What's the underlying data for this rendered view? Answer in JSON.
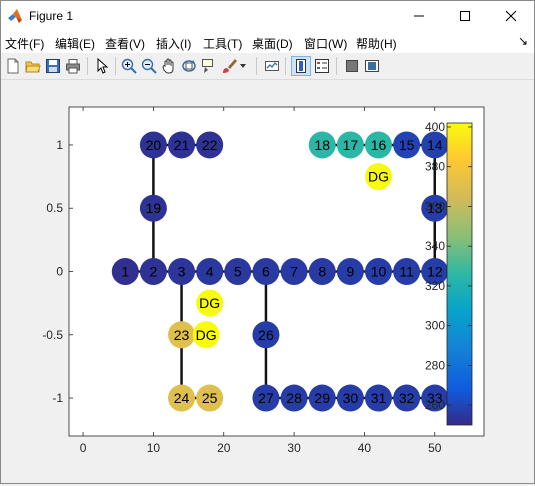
{
  "window": {
    "title": "Figure 1"
  },
  "window_controls": {
    "minimize": "minimize",
    "maximize": "maximize",
    "close": "close"
  },
  "menu": [
    "文件(F)",
    "编辑(E)",
    "查看(V)",
    "插入(I)",
    "工具(T)",
    "桌面(D)",
    "窗口(W)",
    "帮助(H)"
  ],
  "toolbar_icons": [
    "new-figure-icon",
    "open-file-icon",
    "save-icon",
    "print-icon",
    "pointer-icon",
    "zoom-in-icon",
    "zoom-out-icon",
    "pan-icon",
    "rotate-3d-icon",
    "data-cursor-icon",
    "brush-icon",
    "brush-dropdown-icon",
    "link-plot-icon",
    "insert-colorbar-icon",
    "insert-legend-icon",
    "hide-plot-tools-icon",
    "show-plot-tools-icon"
  ],
  "chart_data": {
    "type": "network graph",
    "x_ticks": [
      "0",
      "10",
      "20",
      "30",
      "40",
      "50"
    ],
    "y_ticks": [
      "1",
      "0.5",
      "0",
      "-0.5",
      "-1"
    ],
    "xlim": [
      -2,
      57
    ],
    "ylim": [
      -1.3,
      1.3
    ],
    "colorbar": {
      "ticks": [
        "400",
        "380",
        "360",
        "340",
        "320",
        "300",
        "280",
        "260"
      ],
      "range": [
        250,
        402
      ],
      "colormap": "parula"
    },
    "nodes": [
      {
        "id": "1",
        "x": 6,
        "y": 0,
        "value": 252
      },
      {
        "id": "2",
        "x": 10,
        "y": 0,
        "value": 253
      },
      {
        "id": "3",
        "x": 14,
        "y": 0,
        "value": 254
      },
      {
        "id": "4",
        "x": 18,
        "y": 0,
        "value": 255
      },
      {
        "id": "5",
        "x": 22,
        "y": 0,
        "value": 255
      },
      {
        "id": "6",
        "x": 26,
        "y": 0,
        "value": 256
      },
      {
        "id": "7",
        "x": 30,
        "y": 0,
        "value": 256
      },
      {
        "id": "8",
        "x": 34,
        "y": 0,
        "value": 256
      },
      {
        "id": "9",
        "x": 38,
        "y": 0,
        "value": 257
      },
      {
        "id": "10",
        "x": 42,
        "y": 0,
        "value": 257
      },
      {
        "id": "11",
        "x": 46,
        "y": 0,
        "value": 257
      },
      {
        "id": "12",
        "x": 50,
        "y": 0,
        "value": 257
      },
      {
        "id": "13",
        "x": 50,
        "y": 0.5,
        "value": 257
      },
      {
        "id": "14",
        "x": 50,
        "y": 1,
        "value": 258
      },
      {
        "id": "15",
        "x": 46,
        "y": 1,
        "value": 259
      },
      {
        "id": "16",
        "x": 42,
        "y": 1,
        "value": 325
      },
      {
        "id": "17",
        "x": 38,
        "y": 1,
        "value": 325
      },
      {
        "id": "18",
        "x": 34,
        "y": 1,
        "value": 325
      },
      {
        "id": "19",
        "x": 10,
        "y": 0.5,
        "value": 253
      },
      {
        "id": "20",
        "x": 10,
        "y": 1,
        "value": 253
      },
      {
        "id": "21",
        "x": 14,
        "y": 1,
        "value": 253
      },
      {
        "id": "22",
        "x": 18,
        "y": 1,
        "value": 253
      },
      {
        "id": "23",
        "x": 14,
        "y": -0.5,
        "value": 370
      },
      {
        "id": "24",
        "x": 14,
        "y": -1,
        "value": 370
      },
      {
        "id": "25",
        "x": 18,
        "y": -1,
        "value": 370
      },
      {
        "id": "26",
        "x": 26,
        "y": -0.5,
        "value": 257
      },
      {
        "id": "27",
        "x": 26,
        "y": -1,
        "value": 257
      },
      {
        "id": "28",
        "x": 30,
        "y": -1,
        "value": 257
      },
      {
        "id": "29",
        "x": 34,
        "y": -1,
        "value": 257
      },
      {
        "id": "30",
        "x": 38,
        "y": -1,
        "value": 257
      },
      {
        "id": "31",
        "x": 42,
        "y": -1,
        "value": 257
      },
      {
        "id": "32",
        "x": 46,
        "y": -1,
        "value": 257
      },
      {
        "id": "33",
        "x": 50,
        "y": -1,
        "value": 257
      },
      {
        "id": "DG",
        "x": 42,
        "y": 0.75,
        "value": 402
      },
      {
        "id": "DG",
        "x": 18,
        "y": -0.25,
        "value": 402
      },
      {
        "id": "DG",
        "x": 17.5,
        "y": -0.5,
        "value": 402
      }
    ],
    "edges": [
      [
        "1",
        "2"
      ],
      [
        "2",
        "3"
      ],
      [
        "3",
        "4"
      ],
      [
        "4",
        "5"
      ],
      [
        "5",
        "6"
      ],
      [
        "6",
        "7"
      ],
      [
        "7",
        "8"
      ],
      [
        "8",
        "9"
      ],
      [
        "9",
        "10"
      ],
      [
        "10",
        "11"
      ],
      [
        "11",
        "12"
      ],
      [
        "12",
        "13"
      ],
      [
        "13",
        "14"
      ],
      [
        "14",
        "15"
      ],
      [
        "15",
        "16"
      ],
      [
        "16",
        "17"
      ],
      [
        "17",
        "18"
      ],
      [
        "2",
        "19"
      ],
      [
        "19",
        "20"
      ],
      [
        "20",
        "21"
      ],
      [
        "21",
        "22"
      ],
      [
        "3",
        "23"
      ],
      [
        "23",
        "24"
      ],
      [
        "24",
        "25"
      ],
      [
        "6",
        "26"
      ],
      [
        "26",
        "27"
      ],
      [
        "27",
        "28"
      ],
      [
        "28",
        "29"
      ],
      [
        "29",
        "30"
      ],
      [
        "30",
        "31"
      ],
      [
        "31",
        "32"
      ],
      [
        "32",
        "33"
      ]
    ]
  }
}
